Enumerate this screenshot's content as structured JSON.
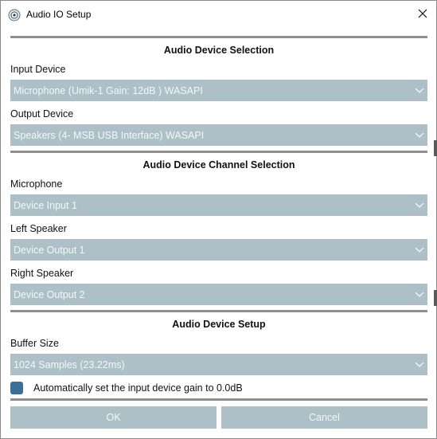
{
  "window": {
    "title": "Audio IO Setup"
  },
  "device_selection": {
    "heading": "Audio Device Selection",
    "input_label": "Input Device",
    "input_value": "Microphone (Umik-1  Gain: 12dB  ) WASAPI",
    "output_label": "Output Device",
    "output_value": "Speakers (4- MSB USB Interface) WASAPI"
  },
  "channel_selection": {
    "heading": "Audio Device Channel Selection",
    "microphone_label": "Microphone",
    "microphone_value": "Device Input 1",
    "left_label": "Left Speaker",
    "left_value": "Device Output 1",
    "right_label": "Right Speaker",
    "right_value": "Device Output 2"
  },
  "device_setup": {
    "heading": "Audio Device Setup",
    "buffer_label": "Buffer Size",
    "buffer_value": "1024 Samples (23.22ms)",
    "auto_gain_label": "Automatically set the input device gain to 0.0dB",
    "auto_gain_checked": true
  },
  "buttons": {
    "ok": "OK",
    "cancel": "Cancel"
  },
  "colors": {
    "dropdown_bg": "#aec0c7",
    "checkbox_fill": "#3a6f99",
    "divider": "#8f8f8f"
  },
  "icons": {
    "app": "audio-app-icon",
    "close": "close-icon",
    "dropdown": "chevron-down-icon"
  }
}
